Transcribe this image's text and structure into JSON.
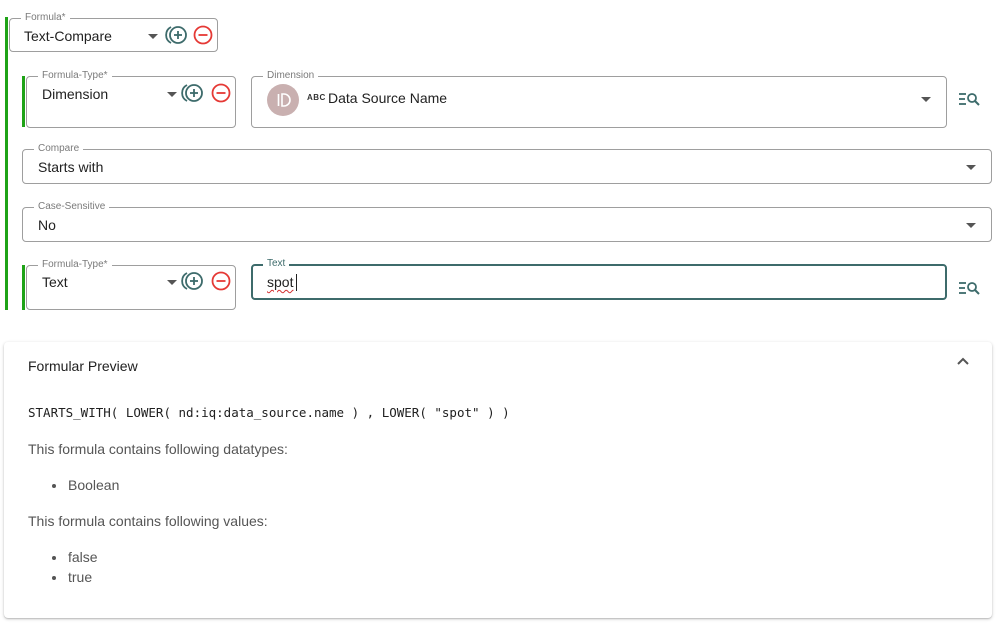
{
  "formula": {
    "legend": "Formula*",
    "value": "Text-Compare"
  },
  "row1": {
    "formula_type": {
      "legend": "Formula-Type*",
      "value": "Dimension"
    },
    "dimension": {
      "legend": "Dimension",
      "type_badge": "ABC",
      "value": "Data Source Name"
    }
  },
  "compare": {
    "legend": "Compare",
    "value": "Starts with"
  },
  "case_sensitive": {
    "legend": "Case-Sensitive",
    "value": "No"
  },
  "row2": {
    "formula_type": {
      "legend": "Formula-Type*",
      "value": "Text"
    },
    "text": {
      "legend": "Text",
      "value": "spot"
    }
  },
  "preview": {
    "title": "Formular Preview",
    "expression": "STARTS_WITH( LOWER( nd:iq:data_source.name ) , LOWER( \"spot\" ) )",
    "datatypes_label": "This formula contains following datatypes:",
    "datatypes": [
      "Boolean"
    ],
    "values_label": "This formula contains following values:",
    "values": [
      "false",
      "true"
    ]
  },
  "colors": {
    "accent_bar": "#1fa317",
    "add_icon": "#3d6b6b",
    "remove_icon": "#e53935",
    "focus_border": "#3d6b6b"
  },
  "icons": {
    "add": "add-circle-outline-icon",
    "remove": "remove-circle-outline-icon",
    "select_lookup": "list-search-icon",
    "dropdown": "chevron-down-icon"
  }
}
